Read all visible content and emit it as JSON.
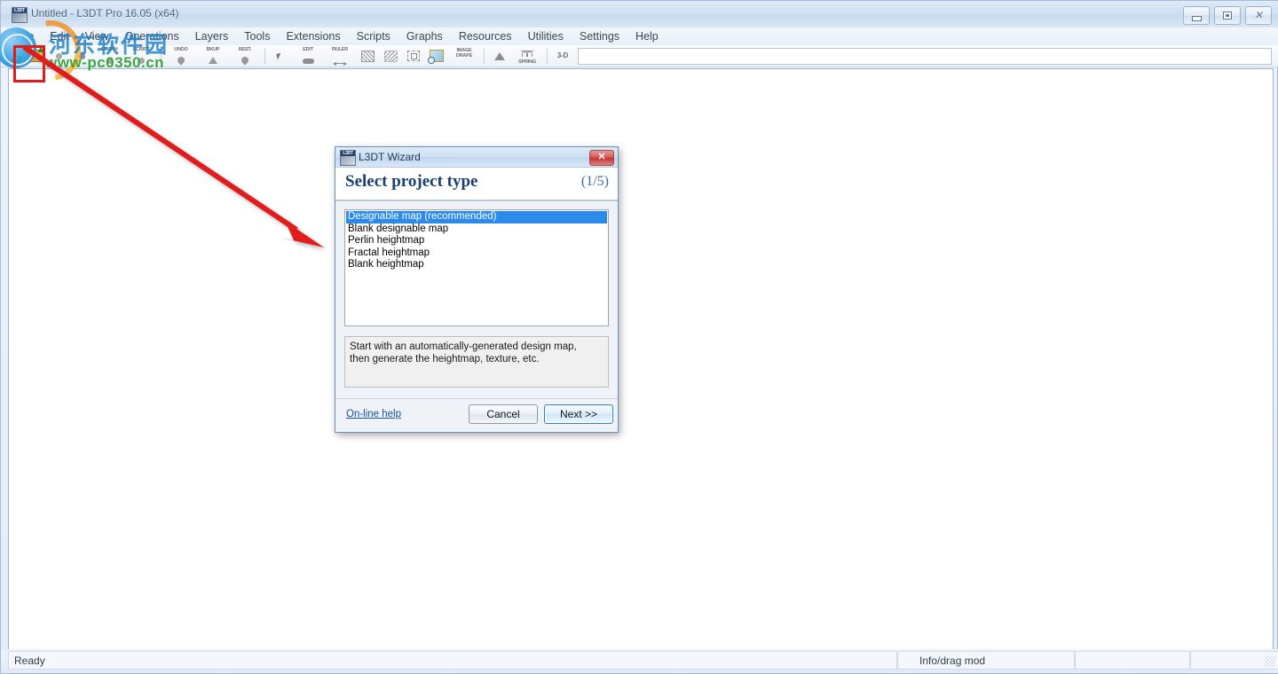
{
  "window": {
    "title": "Untitled - L3DT Pro 16.05 (x64)",
    "icon": "l3dt-app-icon",
    "controls": {
      "minimize": "minimize-icon",
      "maximize": "maximize-icon",
      "close": "close-icon",
      "close_glyph": "✕"
    }
  },
  "menubar": {
    "items": [
      {
        "label": "File"
      },
      {
        "label": "Edit"
      },
      {
        "label": "View"
      },
      {
        "label": "Operations"
      },
      {
        "label": "Layers"
      },
      {
        "label": "Tools"
      },
      {
        "label": "Extensions"
      },
      {
        "label": "Scripts"
      },
      {
        "label": "Graphs"
      },
      {
        "label": "Resources"
      },
      {
        "label": "Utilities"
      },
      {
        "label": "Settings"
      },
      {
        "label": "Help"
      }
    ]
  },
  "toolbar": {
    "buttons": [
      {
        "name": "new-project-button",
        "label": ""
      },
      {
        "name": "open-project-button",
        "label": ""
      },
      {
        "name": "save-project-button",
        "label": ""
      },
      {
        "name": "save-as-button",
        "label": ""
      },
      {
        "name": "graph-button",
        "label": "GRAPH"
      },
      {
        "name": "script-button",
        "label": "SCRIPT"
      },
      {
        "name": "undo-button",
        "label": "UNDO"
      },
      {
        "name": "backup-button",
        "label": "BKUP"
      },
      {
        "name": "restore-button",
        "label": "REST."
      },
      {
        "name": "select-tool-button",
        "label": ""
      },
      {
        "name": "edit-tool-button",
        "label": "EDIT"
      },
      {
        "name": "ruler-tool-button",
        "label": "RULER"
      },
      {
        "name": "mask-tool-button",
        "label": ""
      },
      {
        "name": "region-tool-button",
        "label": ""
      },
      {
        "name": "crop-tool-button",
        "label": ""
      },
      {
        "name": "zoom-tool-button",
        "label": ""
      },
      {
        "name": "image-drape-button",
        "label": "IMAGE\nDRAPE"
      },
      {
        "name": "attributes-button",
        "label": ""
      },
      {
        "name": "spring-button",
        "label": "SPRING"
      },
      {
        "name": "view-3d-button",
        "label": "3-D"
      }
    ]
  },
  "statusbar": {
    "ready": "Ready",
    "mode": "Info/drag mod",
    "coord_x": "",
    "coord_y": ""
  },
  "watermark": {
    "chinese": "河东软件园",
    "url": "www-pc0350.cn"
  },
  "dialog": {
    "titlebar": {
      "title": "L3DT Wizard",
      "close_glyph": "✕",
      "icon": "l3dt-wizard-icon"
    },
    "header": {
      "title": "Select project type",
      "step": "(1/5)"
    },
    "list": {
      "items": [
        {
          "label": "Designable map (recommended)",
          "selected": true
        },
        {
          "label": "Blank designable map",
          "selected": false
        },
        {
          "label": "Perlin heightmap",
          "selected": false
        },
        {
          "label": "Fractal heightmap",
          "selected": false
        },
        {
          "label": "Blank heightmap",
          "selected": false
        }
      ]
    },
    "description": {
      "line1": "Start with an automatically-generated design map,",
      "line2": "then generate the heightmap, texture, etc."
    },
    "footer": {
      "help_link": "On-line help",
      "cancel": "Cancel",
      "next": "Next >>"
    }
  },
  "colors": {
    "selection_blue": "#2c8bea",
    "header_blue": "#1b3f73",
    "annotation_red": "#e01b1b",
    "watermark_green": "#2f9e2f",
    "watermark_blue": "#1f7ec4"
  }
}
